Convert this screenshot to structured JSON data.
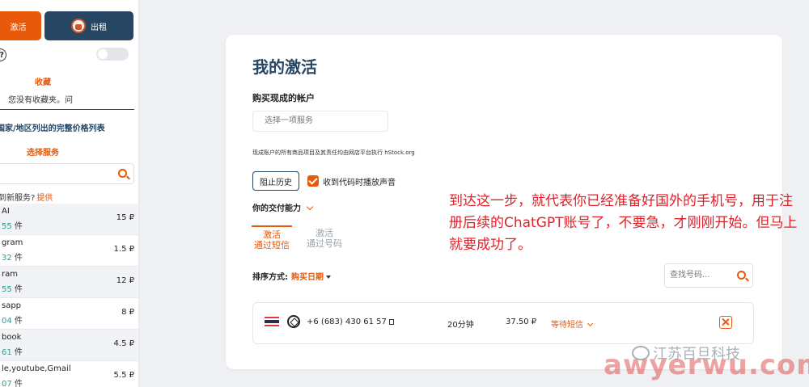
{
  "colors": {
    "accent": "#e8590c",
    "navy": "#264663",
    "annotation": "#e0202a"
  },
  "sidebar": {
    "activate_button": "激活",
    "rent_button": "出租",
    "help_icon_text": "?",
    "favorites_title": "收藏",
    "favorites_empty": "您没有收藏夹。问",
    "price_list_link": "国家/地区列出的完整价格列表",
    "choose_service": "选择服务",
    "not_found": "到新服务?",
    "not_found_link": "提供",
    "services": [
      {
        "name": "AI",
        "count": "55",
        "unit": "件",
        "price": "15 ₽"
      },
      {
        "name": "gram",
        "count": "32",
        "unit": "件",
        "price": "1.5 ₽"
      },
      {
        "name": "ram",
        "count": "55",
        "unit": "件",
        "price": "12 ₽"
      },
      {
        "name": "sapp",
        "count": "04",
        "unit": "件",
        "price": "8 ₽"
      },
      {
        "name": "book",
        "count": "61",
        "unit": "件",
        "price": "4.5 ₽"
      },
      {
        "name": "le,youtube,Gmail",
        "count": "07",
        "unit": "件",
        "price": "5.5 ₽"
      }
    ]
  },
  "main": {
    "title": "我的激活",
    "buy_label": "购买现成的帐户",
    "service_placeholder": "选择一项服务",
    "note": "现成账户的所有商品项目及其责任均由网店平台执行 hStock.org",
    "history_button": "阻止历史",
    "sound_label": "收到代码时播放声音",
    "delivery_label": "你的交付能力",
    "tabs": [
      {
        "line1": "激活",
        "line2": "通过短信"
      },
      {
        "line1": "激活",
        "line2": "通过号码"
      }
    ],
    "sort_label": "排序方式:",
    "sort_value": "购买日期",
    "number_search_placeholder": "查找号码...",
    "activation": {
      "phone": "+6 (683) 430 61 57",
      "duration": "20分钟",
      "price": "37.50 ₽",
      "status": "等待短信"
    }
  },
  "annotation": "到达这一步，就代表你已经准备好国外的手机号，用于注册后续的ChatGPT账号了，不要急，才刚刚开始。但马上就要成功了。",
  "watermark": {
    "cn": "江苏百旦科技",
    "en": "awyerwu.com"
  }
}
